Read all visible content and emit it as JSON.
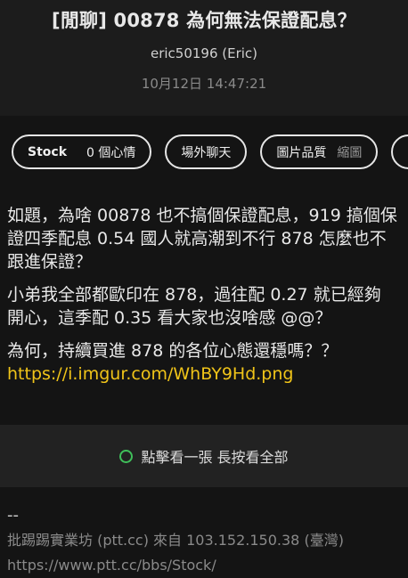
{
  "post": {
    "title": "[閒聊] 00878 為何無法保證配息？",
    "author": "eric50196 (Eric)",
    "time": "10月12日 14:47:21"
  },
  "chips": {
    "board": "Stock",
    "mood": "0 個心情",
    "offtopic": "場外聊天",
    "quality_label": "圖片品質",
    "quality_value": "縮圖"
  },
  "body": {
    "p1": "如題，為啥 00878 也不搞個保證配息，919 搞個保證四季配息 0.54 國人就高潮到不行 878 怎麼也不跟進保證？",
    "p2": "小弟我全部都歐印在 878，過往配 0.27 就已經夠開心，這季配 0.35 看大家也沒啥感 @@？",
    "p3": "為何，持續買進 878 的各位心態還穩嗎？？",
    "link": "https://i.imgur.com/WhBY9Hd.png"
  },
  "image_bar": {
    "label": "點擊看一張 長按看全部"
  },
  "signature": {
    "dash": "--",
    "source": "批踢踢實業坊 (ptt.cc) 來自 103.152.150.38 (臺灣)",
    "url": "https://www.ptt.cc/bbs/Stock/"
  }
}
